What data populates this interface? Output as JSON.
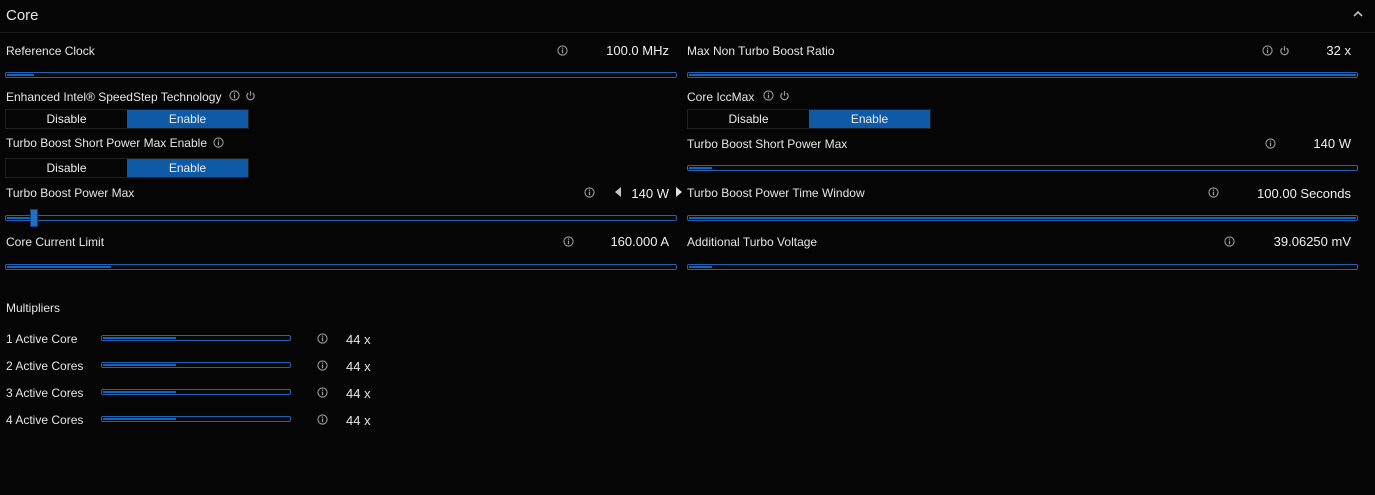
{
  "header": {
    "title": "Core",
    "collapse_icon": "chevron-up-icon"
  },
  "colors": {
    "accent": "#1565c0",
    "background": "#050506"
  },
  "left": {
    "reference_clock": {
      "label": "Reference Clock",
      "value": "100.0 MHz",
      "level": 0.04
    },
    "speedstep": {
      "label": "Enhanced Intel® SpeedStep Technology",
      "disable": "Disable",
      "enable": "Enable",
      "selected": "Enable"
    },
    "short_power_enable": {
      "label": "Turbo Boost Short Power Max Enable",
      "disable": "Disable",
      "enable": "Enable",
      "selected": "Enable"
    },
    "power_max": {
      "label": "Turbo Boost Power Max",
      "value": "140 W",
      "level": 0.04
    },
    "current_limit": {
      "label": "Core Current Limit",
      "value": "160.000 A",
      "level": 0.155
    }
  },
  "right": {
    "non_turbo_ratio": {
      "label": "Max Non Turbo Boost Ratio",
      "value": "32 x",
      "level": 1.0
    },
    "iccmax": {
      "label": "Core IccMax",
      "disable": "Disable",
      "enable": "Enable",
      "selected": "Enable"
    },
    "short_power_max": {
      "label": "Turbo Boost Short Power Max",
      "value": "140 W",
      "level": 0.035
    },
    "time_window": {
      "label": "Turbo Boost Power Time Window",
      "value": "100.00 Seconds",
      "level": 1.0
    },
    "turbo_voltage": {
      "label": "Additional Turbo Voltage",
      "value": "39.06250 mV",
      "level": 0.035
    }
  },
  "multipliers": {
    "title": "Multipliers",
    "items": [
      {
        "label": "1 Active Core",
        "value": "44 x",
        "level": 0.39
      },
      {
        "label": "2 Active Cores",
        "value": "44 x",
        "level": 0.39
      },
      {
        "label": "3 Active Cores",
        "value": "44 x",
        "level": 0.39
      },
      {
        "label": "4 Active Cores",
        "value": "44 x",
        "level": 0.39
      }
    ]
  }
}
